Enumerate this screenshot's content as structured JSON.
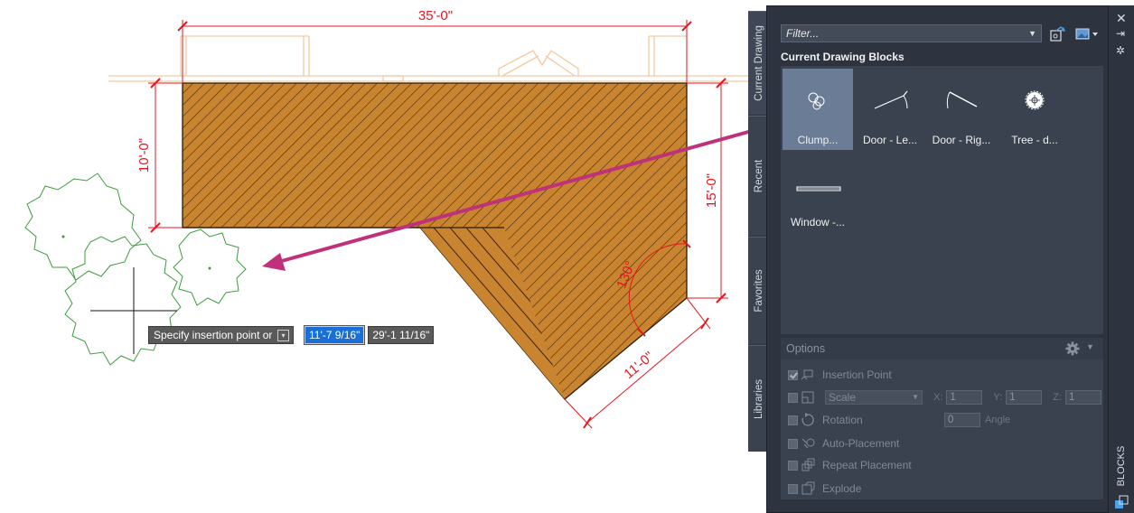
{
  "drawing": {
    "dimensions": {
      "width_top": "35'-0\"",
      "height_left": "10'-0\"",
      "height_right": "15'-0\"",
      "angle": "130°",
      "diagonal": "11'-0\""
    },
    "colors": {
      "deck_fill": "#c8842f",
      "dimension": "#e8141e",
      "house_outline": "#f4c9a0",
      "trees": "#3c9c3c",
      "arrow": "#c0317c"
    }
  },
  "command_tooltip": {
    "prompt": "Specify insertion point or",
    "x_value": "11'-7 9/16\"",
    "y_value": "29'-1 11/16\""
  },
  "palette": {
    "title": "BLOCKS",
    "vertical_tabs": [
      "Current Drawing",
      "Recent",
      "Favorites",
      "Libraries"
    ],
    "active_tab": "Current Drawing",
    "filter_placeholder": "Filter...",
    "section_title": "Current Drawing Blocks",
    "blocks": [
      {
        "label": "Clump...",
        "icon": "clump-icon",
        "selected": true
      },
      {
        "label": "Door - Le...",
        "icon": "door-left-icon",
        "selected": false
      },
      {
        "label": "Door - Rig...",
        "icon": "door-right-icon",
        "selected": false
      },
      {
        "label": "Tree - d...",
        "icon": "tree-icon",
        "selected": false
      },
      {
        "label": "Window -...",
        "icon": "window-icon",
        "selected": false
      }
    ],
    "options": {
      "title": "Options",
      "insertion_point": {
        "label": "Insertion Point",
        "checked": true
      },
      "scale": {
        "mode": "Scale",
        "checked": false,
        "x_label": "X:",
        "x": "1",
        "y_label": "Y:",
        "y": "1",
        "z_label": "Z:",
        "z": "1"
      },
      "rotation": {
        "label": "Rotation",
        "checked": false,
        "value": "0",
        "unit_label": "Angle"
      },
      "auto_placement": {
        "label": "Auto-Placement",
        "checked": false
      },
      "repeat_placement": {
        "label": "Repeat Placement",
        "checked": false
      },
      "explode": {
        "label": "Explode",
        "checked": false
      }
    }
  }
}
